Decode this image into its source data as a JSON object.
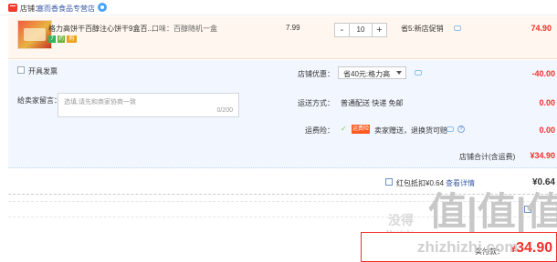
{
  "shop": {
    "label": "店铺：",
    "name": "塞而香食品专营店"
  },
  "item": {
    "title": "格力高饼干百醇注心饼干9盒百...",
    "sku": "口味：百醇随机一盒",
    "badges": [
      "7",
      "药",
      "购"
    ],
    "unit_price": "7.99",
    "quantity": "10",
    "minus": "-",
    "plus": "+",
    "promo": "省5:新店促销",
    "total": "74.90"
  },
  "options": {
    "invoice_label": "开具发票",
    "message_label": "给卖家留言：",
    "message_placeholder": "选填,请先和商家协商一致",
    "message_count": "0/200",
    "shop_discount_label": "店铺优惠：",
    "shop_discount_value": "省40元:格力高",
    "shop_discount_amount": "-40.00",
    "shipping_label": "运送方式：",
    "shipping_value": "普通配送 快递 免邮",
    "shipping_amount": "0.00",
    "insurance_label": "运费险：",
    "insurance_badge": "运费险",
    "insurance_text": "卖家赠送，退换货可赔",
    "insurance_amount": "0.00",
    "store_total_label": "店铺合计(含运费)",
    "store_total_value": "¥34.90"
  },
  "discount": {
    "label": "红包抵扣¥0.64",
    "link": "查看详情",
    "value": "¥0.64"
  },
  "payment": {
    "label": "实付款：",
    "currency": "¥",
    "amount": "34.90"
  },
  "watermark": {
    "brand": "值|值|值",
    "cn": "没得",
    "site": "zhizhizhi.com",
    "small": "Meidebi"
  },
  "colors": {
    "accent": "#f2302a",
    "link": "#3c5da8",
    "panel": "#f2f7ff",
    "item_bg": "#fff7ef"
  }
}
